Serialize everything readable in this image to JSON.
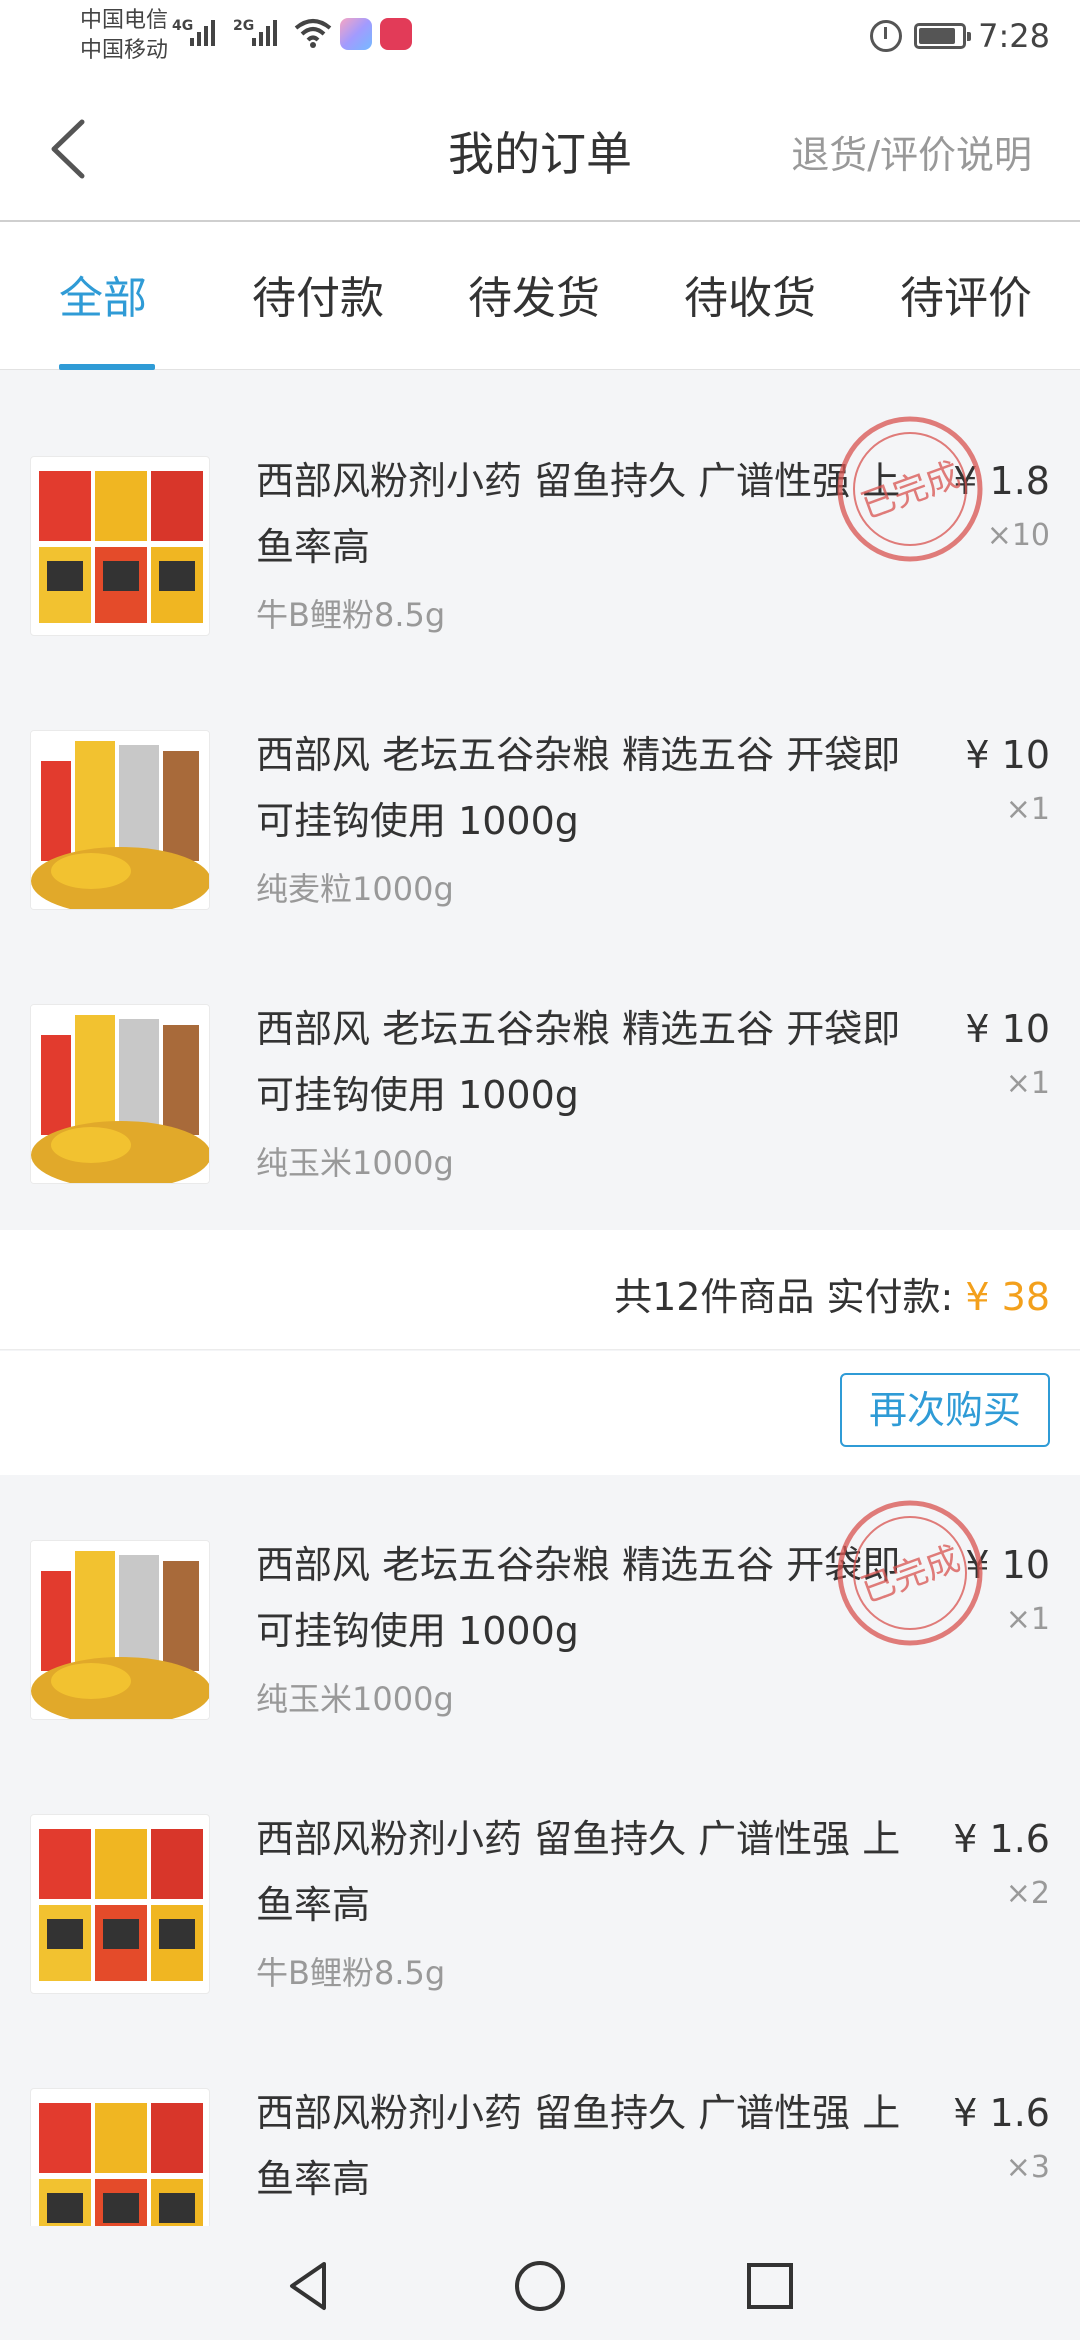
{
  "status_bar": {
    "carrier_1": "中国电信",
    "carrier_2": "中国移动",
    "net_1": "4G",
    "net_2": "2G",
    "time": "7:28",
    "battery_level": 0.85
  },
  "header": {
    "title": "我的订单",
    "link": "退货/评价说明"
  },
  "tabs": [
    {
      "label": "全部",
      "active": true
    },
    {
      "label": "待付款",
      "active": false
    },
    {
      "label": "待发货",
      "active": false
    },
    {
      "label": "待收货",
      "active": false
    },
    {
      "label": "待评价",
      "active": false
    }
  ],
  "orders": [
    {
      "status_stamp": "已完成",
      "items": [
        {
          "title": "西部风粉剂小药 留鱼持久 广谱性强 上鱼率高",
          "spec": "牛B鲤粉8.5g",
          "price": "¥ 1.8",
          "qty": "×10"
        },
        {
          "title": "西部风 老坛五谷杂粮 精选五谷 开袋即可挂钩使用 1000g",
          "spec": "纯麦粒1000g",
          "price": "¥ 10",
          "qty": "×1"
        },
        {
          "title": "西部风 老坛五谷杂粮 精选五谷 开袋即可挂钩使用 1000g",
          "spec": "纯玉米1000g",
          "price": "¥ 10",
          "qty": "×1"
        }
      ],
      "summary_label": "共12件商品  实付款: ",
      "summary_amount": "¥ 38",
      "action_label": "再次购买"
    },
    {
      "status_stamp": "已完成",
      "items": [
        {
          "title": "西部风 老坛五谷杂粮 精选五谷 开袋即可挂钩使用 1000g",
          "spec": "纯玉米1000g",
          "price": "¥ 10",
          "qty": "×1"
        },
        {
          "title": "西部风粉剂小药 留鱼持久 广谱性强 上鱼率高",
          "spec": "牛B鲤粉8.5g",
          "price": "¥ 1.6",
          "qty": "×2"
        },
        {
          "title": "西部风粉剂小药 留鱼持久 广谱性强 上鱼率高",
          "spec": "",
          "price": "¥ 1.6",
          "qty": "×3"
        }
      ]
    }
  ],
  "colors": {
    "accent": "#2f9bd6",
    "price_highlight": "#f3a01c",
    "stamp": "#d9534f"
  },
  "icons": [
    "back-icon",
    "clock-icon",
    "battery-icon",
    "wifi-icon",
    "nav-back-icon",
    "nav-home-icon",
    "nav-recents-icon"
  ]
}
